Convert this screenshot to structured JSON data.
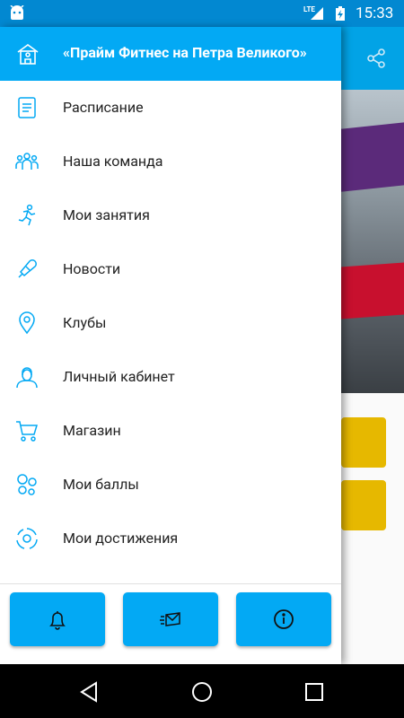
{
  "status_bar": {
    "network": "LTE",
    "time": "15:33"
  },
  "drawer": {
    "header_title": "«Прайм Фитнес на Петра Великого»",
    "items": [
      {
        "label": "Расписание",
        "icon": "schedule-icon"
      },
      {
        "label": "Наша команда",
        "icon": "team-icon"
      },
      {
        "label": "Мои занятия",
        "icon": "running-person-icon"
      },
      {
        "label": "Новости",
        "icon": "megaphone-icon"
      },
      {
        "label": "Клубы",
        "icon": "location-pin-icon"
      },
      {
        "label": "Личный кабинет",
        "icon": "user-icon"
      },
      {
        "label": "Магазин",
        "icon": "cart-icon"
      },
      {
        "label": "Мои баллы",
        "icon": "points-icon"
      },
      {
        "label": "Мои достижения",
        "icon": "achievements-icon"
      }
    ],
    "footer_buttons": [
      "bell-icon",
      "envelope-icon",
      "info-icon"
    ]
  },
  "colors": {
    "accent": "#03a9f4",
    "status_bar": "#0288d1",
    "icon": "#03a9f4",
    "text": "#212121"
  }
}
